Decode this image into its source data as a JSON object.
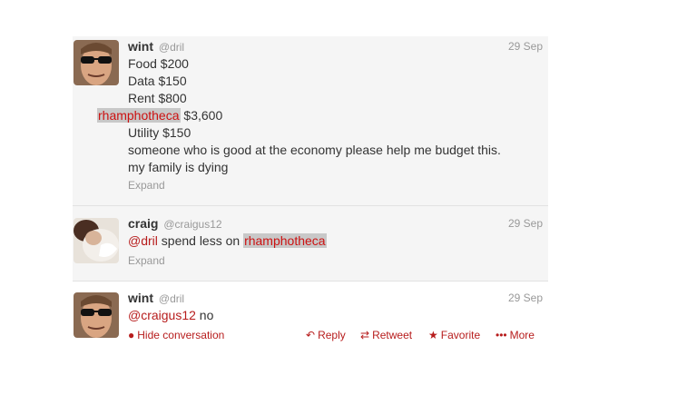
{
  "tweets": [
    {
      "name": "wint",
      "handle": "@dril",
      "time": "29 Sep",
      "lines": [
        "Food $200",
        "Data $150",
        "Rent $800"
      ],
      "highlight_word": "rhamphotheca",
      "highlight_amount": " $3,600",
      "lines_after": [
        "Utility $150",
        "someone who is good at the economy please help me budget this.",
        "my family is dying"
      ],
      "expand": "Expand"
    },
    {
      "name": "craig",
      "handle": "@craigus12",
      "time": "29 Sep",
      "mention": "@dril",
      "text": " spend less on ",
      "highlight_word": "rhamphotheca",
      "expand": "Expand"
    },
    {
      "name": "wint",
      "handle": "@dril",
      "time": "29 Sep",
      "mention": "@craigus12",
      "text": " no",
      "actions": {
        "hide": "Hide conversation",
        "reply": "Reply",
        "retweet": "Retweet",
        "favorite": "Favorite",
        "more": "More"
      }
    }
  ],
  "icons": {
    "hide": "speech-bubble-icon",
    "reply": "reply-arrow-icon",
    "retweet": "retweet-icon",
    "favorite": "star-icon",
    "more": "ellipsis-icon"
  },
  "colors": {
    "link": "#b71c1c",
    "highlight_bg": "#c8c8c8",
    "muted": "#999999"
  }
}
